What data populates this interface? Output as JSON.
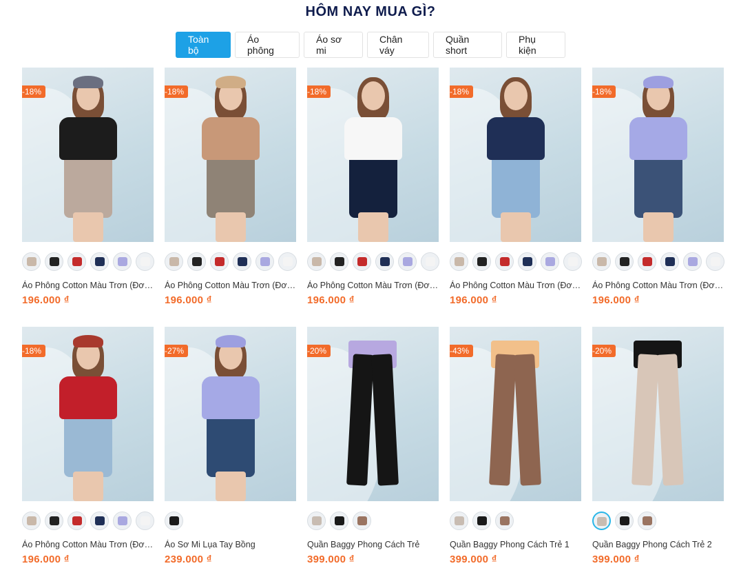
{
  "section_title": "HÔM NAY MUA GÌ?",
  "tabs": [
    "Toàn bộ",
    "Áo phông",
    "Áo sơ mi",
    "Chân váy",
    "Quần short",
    "Phụ kiện"
  ],
  "active_tab": "Toàn bộ",
  "products": [
    {
      "name": "Áo Phông Cotton Màu Trơn (Đơn...",
      "price": "196.000 ₫",
      "discount": "-18%",
      "top": "#1c1c1c",
      "bottom": "#bba99d",
      "hat": "#6b6f80",
      "swatches": [
        "#c9b8a9",
        "#222222",
        "#c42b2b",
        "#1f2f56",
        "#a9a8e0",
        "#f4f4f4"
      ]
    },
    {
      "name": "Áo Phông Cotton Màu Trơn (Đơn...",
      "price": "196.000 ₫",
      "discount": "-18%",
      "top": "#c89878",
      "bottom": "#8f8376",
      "hat": "#d0ad86",
      "swatches": [
        "#c9b8a9",
        "#222222",
        "#c42b2b",
        "#1f2f56",
        "#a9a8e0",
        "#f4f4f4"
      ]
    },
    {
      "name": "Áo Phông Cotton Màu Trơn (Đơn...",
      "price": "196.000 ₫",
      "discount": "-18%",
      "top": "#f7f7f7",
      "bottom": "#14213d",
      "hat": "",
      "swatches": [
        "#c9b8a9",
        "#222222",
        "#c42b2b",
        "#1f2f56",
        "#a9a8e0",
        "#f4f4f4"
      ]
    },
    {
      "name": "Áo Phông Cotton Màu Trơn (Đơn...",
      "price": "196.000 ₫",
      "discount": "-18%",
      "top": "#1f2f56",
      "bottom": "#8fb3d6",
      "hat": "",
      "swatches": [
        "#c9b8a9",
        "#222222",
        "#c42b2b",
        "#1f2f56",
        "#a9a8e0",
        "#f4f4f4"
      ]
    },
    {
      "name": "Áo Phông Cotton Màu Trơn (Đơn...",
      "price": "196.000 ₫",
      "discount": "-18%",
      "top": "#a5a9e6",
      "bottom": "#3b5277",
      "hat": "#9d9fe0",
      "swatches": [
        "#c9b8a9",
        "#222222",
        "#c42b2b",
        "#1f2f56",
        "#a9a8e0",
        "#f4f4f4"
      ]
    },
    {
      "name": "Áo Phông Cotton Màu Trơn (Đơn...",
      "price": "196.000 ₫",
      "discount": "-18%",
      "top": "#c21f2a",
      "bottom": "#9ab9d4",
      "hat": "#a8392d",
      "swatches": [
        "#c9b8a9",
        "#222222",
        "#c42b2b",
        "#1f2f56",
        "#a9a8e0",
        "#f4f4f4"
      ]
    },
    {
      "name": "Áo Sơ Mi Lụa Tay Bồng",
      "price": "239.000 ₫",
      "discount": "-27%",
      "top": "#a5a9e6",
      "bottom": "#2e4b73",
      "hat": "#9d9fe0",
      "swatches": [
        "#1a1a1a"
      ]
    },
    {
      "name": "Quần Baggy Phong Cách Trẻ",
      "price": "399.000 ₫",
      "discount": "-20%",
      "pants": "#151515",
      "waist_top": "#b7a8e0",
      "swatches": [
        "#c8bcb2",
        "#1a1a1a",
        "#9a7461"
      ]
    },
    {
      "name": "Quần Baggy Phong Cách Trẻ 1",
      "price": "399.000 ₫",
      "discount": "-43%",
      "pants": "#8e6550",
      "waist_top": "#f2c08a",
      "swatches": [
        "#c8bcb2",
        "#1a1a1a",
        "#9a7461"
      ]
    },
    {
      "name": "Quần Baggy Phong Cách Trẻ 2",
      "price": "399.000 ₫",
      "discount": "-20%",
      "pants": "#d8c6b8",
      "waist_top": "#151515",
      "swatches": [
        "#c8bcb2",
        "#1a1a1a",
        "#9a7461"
      ]
    }
  ]
}
